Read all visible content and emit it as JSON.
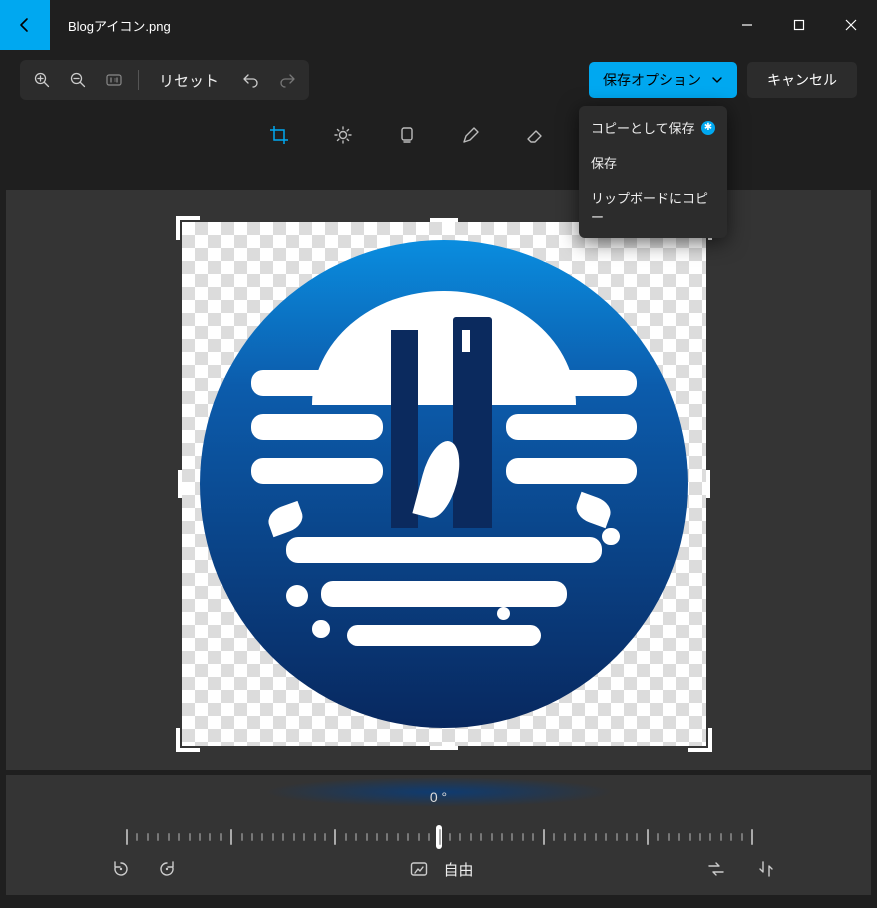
{
  "titlebar": {
    "filename": "Blogアイコン.png"
  },
  "toolbar": {
    "reset_label": "リセット",
    "save_options_label": "保存オプション",
    "cancel_label": "キャンセル"
  },
  "save_dropdown": {
    "items": [
      {
        "label": "コピーとして保存",
        "starred": true
      },
      {
        "label": "保存",
        "starred": false
      },
      {
        "label": "リップボードにコピー",
        "starred": false
      }
    ]
  },
  "canvas": {
    "rotation_label": "0 °",
    "aspect_label": "自由"
  }
}
